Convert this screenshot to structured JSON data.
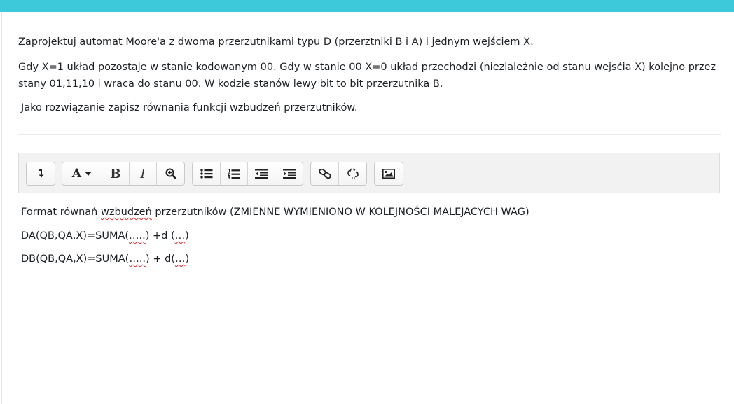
{
  "question": {
    "line1": "Zaprojektuj automat Moore'a z dwoma przerzutnikami typu D  (przerztniki B i A) i jednym wejściem X.",
    "line2": "Gdy X=1 układ pozostaje w stanie  kodowanym  00. Gdy w stanie 00  X=0  układ przechodzi (niezlależnie od stanu wejsćia X) kolejno przez stany 01,11,10 i wraca do stanu 00. W kodzie stanów lewy bit to bit przerzutnika B.",
    "line3": "Jako rozwiązanie zapisz równania funkcji wzbudzeń przerzutników."
  },
  "toolbar": {
    "icons": [
      "collapse-icon",
      "font-color-icon",
      "bold-icon",
      "italic-icon",
      "zoom-icon",
      "unordered-list-icon",
      "ordered-list-icon",
      "outdent-icon",
      "indent-icon",
      "link-icon",
      "unlink-icon",
      "image-icon"
    ],
    "font_color_label": "A",
    "bold_label": "B",
    "italic_label": "I"
  },
  "editor": {
    "line1_a": "Format równań ",
    "line1_b": "wzbudzeń",
    "line1_c": " przerzutników (ZMIENNE WYMIENIONO W KOLEJNOŚCI MALEJACYCH WAG)",
    "line2_a": "DA(QB,QA,X)=SUMA(",
    "line2_b": "…..",
    "line2_c": ") +d (",
    "line2_d": "…",
    "line2_e": ")",
    "line3_a": "DB(QB,QA,X)=SUMA(",
    "line3_b": "…..",
    "line3_c": ") + d(",
    "line3_d": "…",
    "line3_e": ")"
  }
}
